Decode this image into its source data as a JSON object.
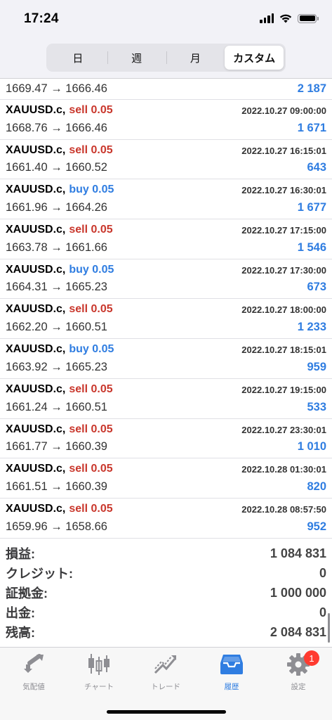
{
  "status_bar": {
    "time": "17:24"
  },
  "segments": [
    {
      "label": "日",
      "active": false
    },
    {
      "label": "週",
      "active": false
    },
    {
      "label": "月",
      "active": false
    },
    {
      "label": "カスタム",
      "active": true
    }
  ],
  "top_partial": {
    "prices": "1669.47 → 1666.46",
    "profit": "2 187"
  },
  "trades": [
    {
      "symbol": "XAUUSD.c,",
      "side": "sell",
      "volume": "0.05",
      "datetime": "2022.10.27 09:00:00",
      "prices": "1668.76 → 1666.46",
      "profit": "1 671"
    },
    {
      "symbol": "XAUUSD.c,",
      "side": "sell",
      "volume": "0.05",
      "datetime": "2022.10.27 16:15:01",
      "prices": "1661.40 → 1660.52",
      "profit": "643"
    },
    {
      "symbol": "XAUUSD.c,",
      "side": "buy",
      "volume": "0.05",
      "datetime": "2022.10.27 16:30:01",
      "prices": "1661.96 → 1664.26",
      "profit": "1 677"
    },
    {
      "symbol": "XAUUSD.c,",
      "side": "sell",
      "volume": "0.05",
      "datetime": "2022.10.27 17:15:00",
      "prices": "1663.78 → 1661.66",
      "profit": "1 546"
    },
    {
      "symbol": "XAUUSD.c,",
      "side": "buy",
      "volume": "0.05",
      "datetime": "2022.10.27 17:30:00",
      "prices": "1664.31 → 1665.23",
      "profit": "673"
    },
    {
      "symbol": "XAUUSD.c,",
      "side": "sell",
      "volume": "0.05",
      "datetime": "2022.10.27 18:00:00",
      "prices": "1662.20 → 1660.51",
      "profit": "1 233"
    },
    {
      "symbol": "XAUUSD.c,",
      "side": "buy",
      "volume": "0.05",
      "datetime": "2022.10.27 18:15:01",
      "prices": "1663.92 → 1665.23",
      "profit": "959"
    },
    {
      "symbol": "XAUUSD.c,",
      "side": "sell",
      "volume": "0.05",
      "datetime": "2022.10.27 19:15:00",
      "prices": "1661.24 → 1660.51",
      "profit": "533"
    },
    {
      "symbol": "XAUUSD.c,",
      "side": "sell",
      "volume": "0.05",
      "datetime": "2022.10.27 23:30:01",
      "prices": "1661.77 → 1660.39",
      "profit": "1 010"
    },
    {
      "symbol": "XAUUSD.c,",
      "side": "sell",
      "volume": "0.05",
      "datetime": "2022.10.28 01:30:01",
      "prices": "1661.51 → 1660.39",
      "profit": "820"
    },
    {
      "symbol": "XAUUSD.c,",
      "side": "sell",
      "volume": "0.05",
      "datetime": "2022.10.28 08:57:50",
      "prices": "1659.96 → 1658.66",
      "profit": "952"
    }
  ],
  "summary": [
    {
      "label": "損益:",
      "value": "1 084 831"
    },
    {
      "label": "クレジット:",
      "value": "0"
    },
    {
      "label": "証拠金:",
      "value": "1 000 000"
    },
    {
      "label": "出金:",
      "value": "0"
    },
    {
      "label": "残高:",
      "value": "2 084 831"
    }
  ],
  "tabbar": {
    "items": [
      {
        "label": "気配値",
        "icon": "quotes-icon",
        "active": false
      },
      {
        "label": "チャート",
        "icon": "chart-icon",
        "active": false
      },
      {
        "label": "トレード",
        "icon": "trade-icon",
        "active": false
      },
      {
        "label": "履歴",
        "icon": "history-icon",
        "active": true
      },
      {
        "label": "設定",
        "icon": "settings-icon",
        "active": false
      }
    ],
    "settings_badge": "1"
  },
  "colors": {
    "sell": "#c9372c",
    "buy": "#2f7de1",
    "active_tab": "#2f7de1",
    "inactive_tab": "#8e8e93",
    "badge": "#ff3b30"
  }
}
